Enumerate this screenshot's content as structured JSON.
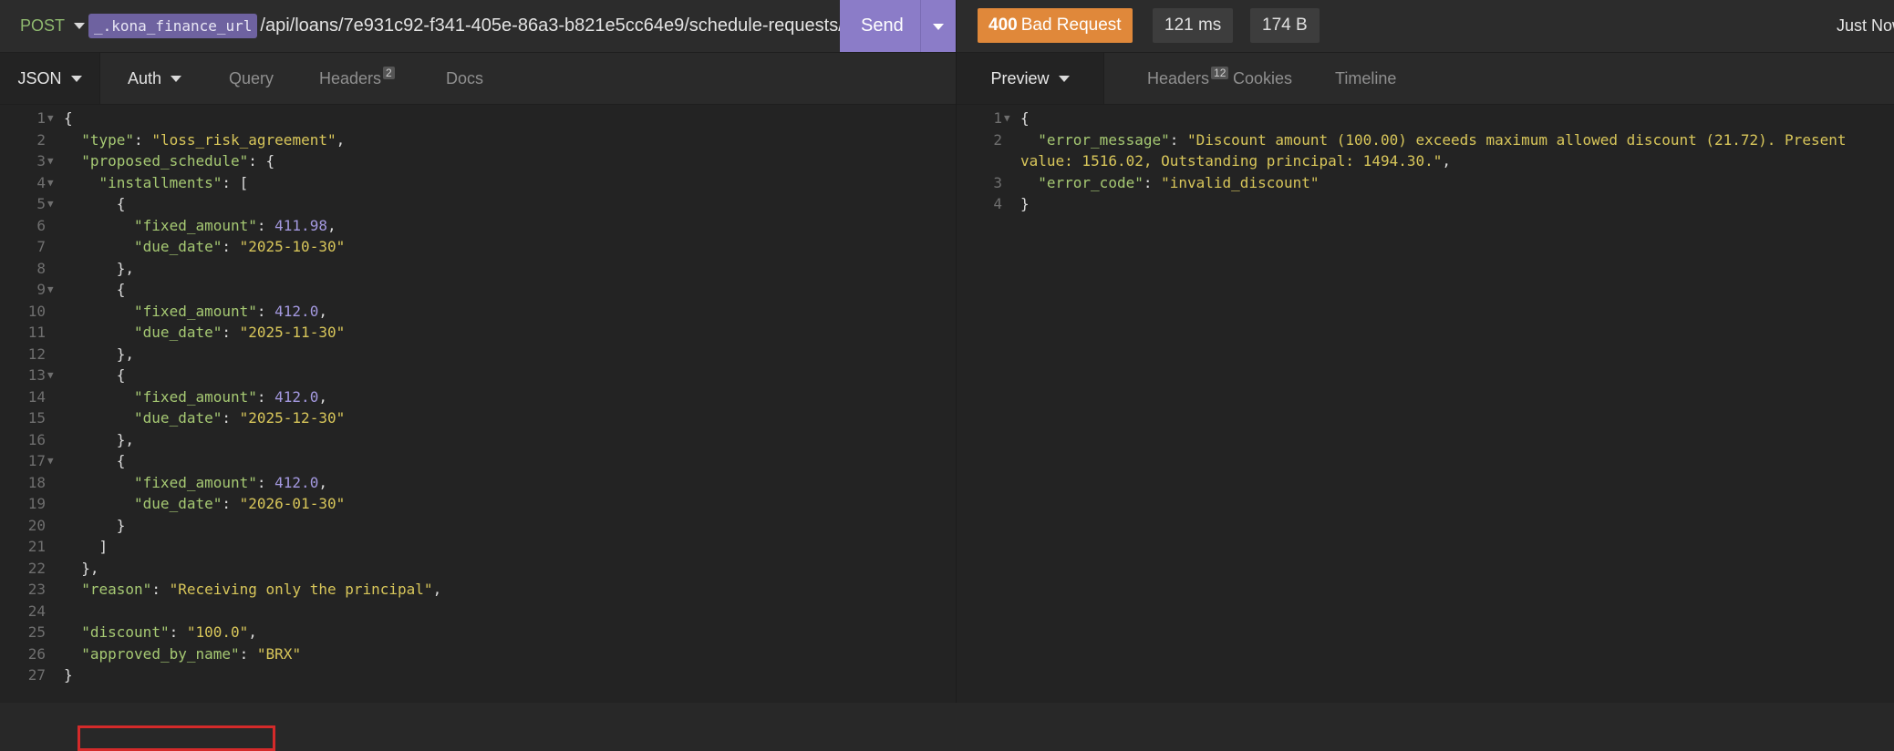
{
  "request": {
    "method": "POST",
    "env_var": "_.kona_finance_url",
    "url_path": "/api/loans/7e931c92-f341-405e-86a3-b821e5cc64e9/schedule-requests/",
    "send_label": "Send"
  },
  "response": {
    "status_code": "400",
    "status_text": "Bad Request",
    "time": "121 ms",
    "size": "174 B",
    "timestamp": "Just Now"
  },
  "request_tabs": {
    "body": "JSON",
    "auth": "Auth",
    "query": "Query",
    "headers": "Headers",
    "headers_count": "2",
    "docs": "Docs"
  },
  "response_tabs": {
    "preview": "Preview",
    "headers": "Headers",
    "headers_count": "12",
    "cookies": "Cookies",
    "timeline": "Timeline"
  },
  "request_body_lines": [
    {
      "n": "1",
      "fold": true,
      "indent": 0,
      "tokens": [
        {
          "t": "p",
          "v": "{"
        }
      ]
    },
    {
      "n": "2",
      "indent": 2,
      "tokens": [
        {
          "t": "k",
          "v": "\"type\""
        },
        {
          "t": "p",
          "v": ": "
        },
        {
          "t": "s",
          "v": "\"loss_risk_agreement\""
        },
        {
          "t": "p",
          "v": ","
        }
      ]
    },
    {
      "n": "3",
      "fold": true,
      "indent": 2,
      "tokens": [
        {
          "t": "k",
          "v": "\"proposed_schedule\""
        },
        {
          "t": "p",
          "v": ": {"
        }
      ]
    },
    {
      "n": "4",
      "fold": true,
      "indent": 4,
      "tokens": [
        {
          "t": "k",
          "v": "\"installments\""
        },
        {
          "t": "p",
          "v": ": ["
        }
      ]
    },
    {
      "n": "5",
      "fold": true,
      "indent": 6,
      "tokens": [
        {
          "t": "p",
          "v": "{"
        }
      ]
    },
    {
      "n": "6",
      "indent": 8,
      "tokens": [
        {
          "t": "k",
          "v": "\"fixed_amount\""
        },
        {
          "t": "p",
          "v": ": "
        },
        {
          "t": "n",
          "v": "411.98"
        },
        {
          "t": "p",
          "v": ","
        }
      ]
    },
    {
      "n": "7",
      "indent": 8,
      "tokens": [
        {
          "t": "k",
          "v": "\"due_date\""
        },
        {
          "t": "p",
          "v": ": "
        },
        {
          "t": "s",
          "v": "\"2025-10-30\""
        }
      ]
    },
    {
      "n": "8",
      "indent": 6,
      "tokens": [
        {
          "t": "p",
          "v": "},"
        }
      ]
    },
    {
      "n": "9",
      "fold": true,
      "indent": 6,
      "tokens": [
        {
          "t": "p",
          "v": "{"
        }
      ]
    },
    {
      "n": "10",
      "indent": 8,
      "tokens": [
        {
          "t": "k",
          "v": "\"fixed_amount\""
        },
        {
          "t": "p",
          "v": ": "
        },
        {
          "t": "n",
          "v": "412.0"
        },
        {
          "t": "p",
          "v": ","
        }
      ]
    },
    {
      "n": "11",
      "indent": 8,
      "tokens": [
        {
          "t": "k",
          "v": "\"due_date\""
        },
        {
          "t": "p",
          "v": ": "
        },
        {
          "t": "s",
          "v": "\"2025-11-30\""
        }
      ]
    },
    {
      "n": "12",
      "indent": 6,
      "tokens": [
        {
          "t": "p",
          "v": "},"
        }
      ]
    },
    {
      "n": "13",
      "fold": true,
      "indent": 6,
      "tokens": [
        {
          "t": "p",
          "v": "{"
        }
      ]
    },
    {
      "n": "14",
      "indent": 8,
      "tokens": [
        {
          "t": "k",
          "v": "\"fixed_amount\""
        },
        {
          "t": "p",
          "v": ": "
        },
        {
          "t": "n",
          "v": "412.0"
        },
        {
          "t": "p",
          "v": ","
        }
      ]
    },
    {
      "n": "15",
      "indent": 8,
      "tokens": [
        {
          "t": "k",
          "v": "\"due_date\""
        },
        {
          "t": "p",
          "v": ": "
        },
        {
          "t": "s",
          "v": "\"2025-12-30\""
        }
      ]
    },
    {
      "n": "16",
      "indent": 6,
      "tokens": [
        {
          "t": "p",
          "v": "},"
        }
      ]
    },
    {
      "n": "17",
      "fold": true,
      "indent": 6,
      "tokens": [
        {
          "t": "p",
          "v": "{"
        }
      ]
    },
    {
      "n": "18",
      "indent": 8,
      "tokens": [
        {
          "t": "k",
          "v": "\"fixed_amount\""
        },
        {
          "t": "p",
          "v": ": "
        },
        {
          "t": "n",
          "v": "412.0"
        },
        {
          "t": "p",
          "v": ","
        }
      ]
    },
    {
      "n": "19",
      "indent": 8,
      "tokens": [
        {
          "t": "k",
          "v": "\"due_date\""
        },
        {
          "t": "p",
          "v": ": "
        },
        {
          "t": "s",
          "v": "\"2026-01-30\""
        }
      ]
    },
    {
      "n": "20",
      "indent": 6,
      "tokens": [
        {
          "t": "p",
          "v": "}"
        }
      ]
    },
    {
      "n": "21",
      "indent": 4,
      "tokens": [
        {
          "t": "p",
          "v": "]"
        }
      ]
    },
    {
      "n": "22",
      "indent": 2,
      "tokens": [
        {
          "t": "p",
          "v": "},"
        }
      ]
    },
    {
      "n": "23",
      "indent": 2,
      "tokens": [
        {
          "t": "k",
          "v": "\"reason\""
        },
        {
          "t": "p",
          "v": ": "
        },
        {
          "t": "s",
          "v": "\"Receiving only the principal\""
        },
        {
          "t": "p",
          "v": ","
        }
      ]
    },
    {
      "n": "24",
      "indent": 0,
      "tokens": []
    },
    {
      "n": "25",
      "indent": 2,
      "highlight": true,
      "tokens": [
        {
          "t": "k",
          "v": "\"discount\""
        },
        {
          "t": "p",
          "v": ": "
        },
        {
          "t": "s",
          "v": "\"100.0\""
        },
        {
          "t": "p",
          "v": ","
        }
      ]
    },
    {
      "n": "26",
      "indent": 2,
      "tokens": [
        {
          "t": "k",
          "v": "\"approved_by_name\""
        },
        {
          "t": "p",
          "v": ": "
        },
        {
          "t": "s",
          "v": "\"BRX\""
        }
      ]
    },
    {
      "n": "27",
      "indent": 0,
      "tokens": [
        {
          "t": "p",
          "v": "}"
        }
      ]
    }
  ],
  "response_body_lines": [
    {
      "n": "1",
      "fold": true,
      "indent": 0,
      "tokens": [
        {
          "t": "p",
          "v": "{"
        }
      ]
    },
    {
      "n": "2",
      "indent": 2,
      "tokens": [
        {
          "t": "k",
          "v": "\"error_message\""
        },
        {
          "t": "p",
          "v": ": "
        },
        {
          "t": "s",
          "v": "\"Discount amount (100.00) exceeds maximum allowed discount (21.72). Present"
        }
      ]
    },
    {
      "n": "",
      "indent": 0,
      "tokens": [
        {
          "t": "s",
          "v": "value: 1516.02, Outstanding principal: 1494.30.\""
        },
        {
          "t": "p",
          "v": ","
        }
      ]
    },
    {
      "n": "3",
      "indent": 2,
      "tokens": [
        {
          "t": "k",
          "v": "\"error_code\""
        },
        {
          "t": "p",
          "v": ": "
        },
        {
          "t": "s",
          "v": "\"invalid_discount\""
        }
      ]
    },
    {
      "n": "4",
      "indent": 0,
      "tokens": [
        {
          "t": "p",
          "v": "}"
        }
      ]
    }
  ]
}
